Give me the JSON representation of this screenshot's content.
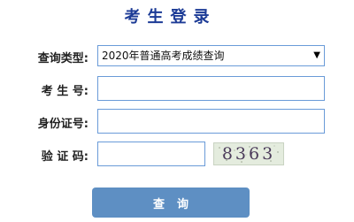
{
  "header": {
    "title": "考生登录"
  },
  "form": {
    "query_type_label": "查询类型:",
    "query_type_value": "2020年普通高考成绩查询",
    "exam_number_label": "考 生 号:",
    "exam_number_value": "",
    "id_number_label": "身份证号:",
    "id_number_value": "",
    "captcha_label": "验 证 码:",
    "captcha_value": "",
    "captcha_text": "8363",
    "submit_label": "查询"
  },
  "icons": {
    "select_arrow": "triangle-down-icon"
  },
  "colors": {
    "title": "#1c3b96",
    "input_border": "#6a9bd8",
    "button": "#5e8fc3",
    "captcha_bg": "#e4ecde"
  }
}
